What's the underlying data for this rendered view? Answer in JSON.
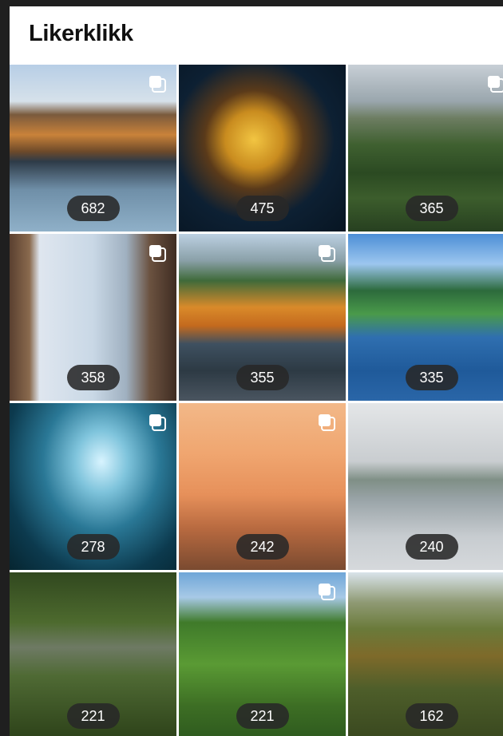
{
  "page": {
    "title": "Likerklikk"
  },
  "icons": {
    "multi_post": "multiple-photos-icon"
  },
  "tiles": [
    {
      "likes": "682",
      "multi": true
    },
    {
      "likes": "475",
      "multi": false
    },
    {
      "likes": "365",
      "multi": true
    },
    {
      "likes": "358",
      "multi": true
    },
    {
      "likes": "355",
      "multi": true
    },
    {
      "likes": "335",
      "multi": false
    },
    {
      "likes": "278",
      "multi": true
    },
    {
      "likes": "242",
      "multi": true
    },
    {
      "likes": "240",
      "multi": false
    },
    {
      "likes": "221",
      "multi": false
    },
    {
      "likes": "221",
      "multi": true
    },
    {
      "likes": "162",
      "multi": false
    }
  ]
}
